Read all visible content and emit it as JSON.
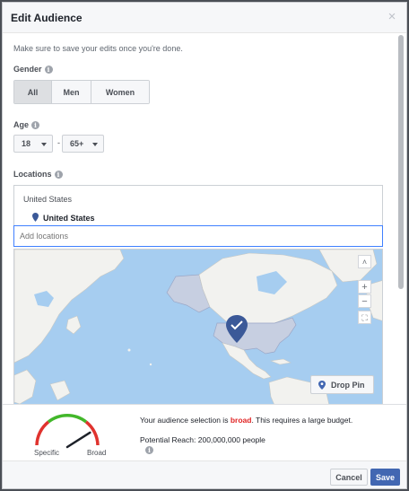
{
  "dialog": {
    "title": "Edit Audience",
    "close_glyph": "×"
  },
  "hint": "Make sure to save your edits once you're done.",
  "gender": {
    "label": "Gender",
    "options": [
      "All",
      "Men",
      "Women"
    ],
    "selected": "All"
  },
  "age": {
    "label": "Age",
    "min": "18",
    "separator": "-",
    "max": "65+"
  },
  "locations": {
    "label": "Locations",
    "group": "United States",
    "selected_item": "United States",
    "input_placeholder": "Add locations"
  },
  "map": {
    "drop_pin_label": "Drop Pin",
    "controls": {
      "collapse": "˄",
      "zoom_in": "+",
      "zoom_out": "−",
      "fullscreen": "⛶"
    },
    "colors": {
      "water": "#a6cdf0",
      "land": "#f2f2ef",
      "selected": "#c7cfe1",
      "pin": "#3b5998"
    }
  },
  "audience": {
    "text_prefix": "Your audience selection is ",
    "text_status": "broad",
    "text_suffix": ". This requires a large budget.",
    "reach_text": "Potential Reach: 200,000,000 people",
    "gauge_left": "Specific",
    "gauge_right": "Broad",
    "gauge_level": 0.82
  },
  "buttons": {
    "cancel": "Cancel",
    "save": "Save"
  },
  "colors": {
    "accent": "#4267b2",
    "broad": "#e02424"
  }
}
